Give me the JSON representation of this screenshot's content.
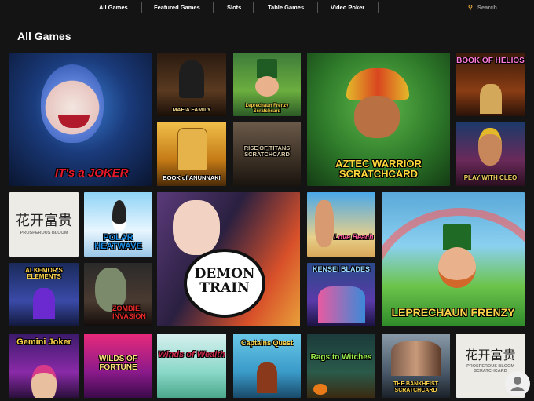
{
  "nav": {
    "items": [
      "All Games",
      "Featured Games",
      "Slots",
      "Table Games",
      "Video Poker"
    ],
    "search_placeholder": "Search"
  },
  "page": {
    "title": "All Games"
  },
  "games": {
    "joker": "IT's a JOKER",
    "mafia": "MAFIA FAMILY",
    "leprechaun_small": "Leprechaun Frenzy Scratchcard",
    "aztec": "AZTEC WARRIOR SCRATCHCARD",
    "book_helios": "BOOK OF HELIOS",
    "annunaki": "BOOK of ANUNNAKI",
    "titans": "RISE OF TITANS SCRATCHCARD",
    "cleo": "PLAY WITH CLEO",
    "prosperous": "PROSPEROUS BLOOM",
    "polar": "POLAR HEATWAVE",
    "demon": "DEMON TRAIN",
    "beach": "Love Beach",
    "leprechaun_big": "LEPRECHAUN FRENZY",
    "alkemor": "ALKEMOR'S ELEMENTS",
    "zombie": "ZOMBIE INVASION",
    "kensei": "KENSEI BLADES",
    "gemini": "Gemini Joker",
    "wilds": "WILDS OF FORTUNE",
    "winds": "Winds of Wealth",
    "captains": "Captains Quest",
    "rags": "Rags to Witches",
    "bankheist": "THE BANKHEIST SCRATCHCARD",
    "prosperous_scratch": "PROSPEROUS BLOOM SCRATCHCARD"
  }
}
